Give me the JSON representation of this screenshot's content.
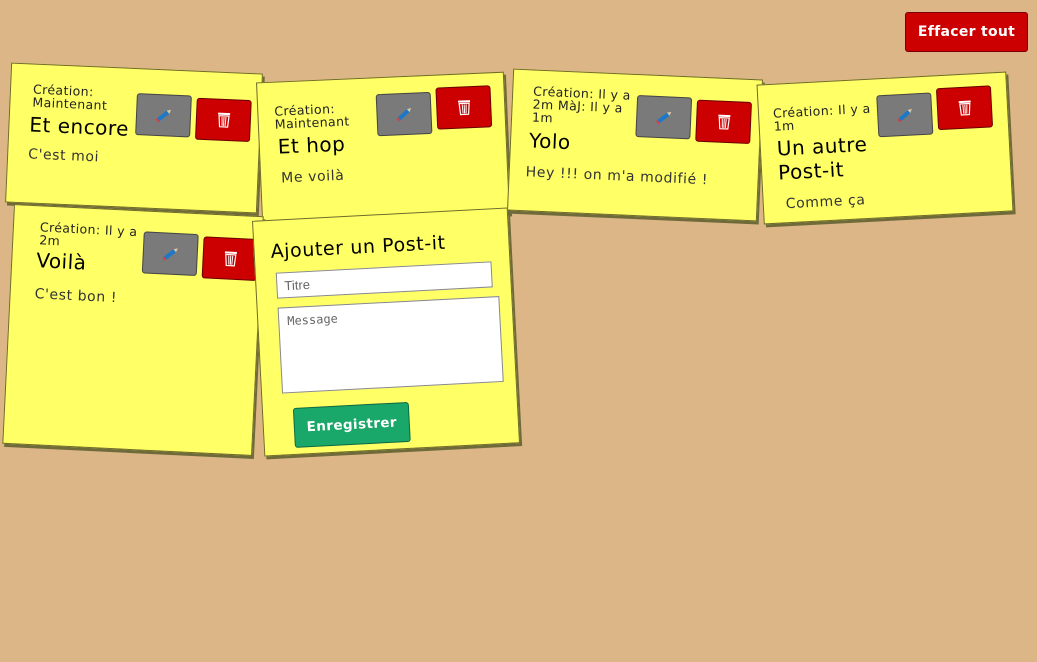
{
  "toolbar": {
    "clear_all_label": "Effacer tout"
  },
  "notes": [
    {
      "meta": "Création: Maintenant",
      "title": "Et encore",
      "text": "C'est moi"
    },
    {
      "meta": "Création: Maintenant",
      "title": "Et hop",
      "text": "Me voilà"
    },
    {
      "meta": "Création: Il y a 2m MàJ: Il y a 1m",
      "title": "Yolo",
      "text": "Hey !!! on m'a modifié !"
    },
    {
      "meta": "Création: Il y a 1m",
      "title": "Un autre Post-it",
      "text": "Comme ça"
    },
    {
      "meta": "Création: Il y a 2m",
      "title": "Voilà",
      "text": "C'est bon !"
    }
  ],
  "form": {
    "heading": "Ajouter un Post-it",
    "title_placeholder": "Titre",
    "message_placeholder": "Message",
    "submit_label": "Enregistrer"
  },
  "icons": {
    "edit": "pencil-icon",
    "delete": "trash-icon"
  },
  "colors": {
    "background": "#ddb688",
    "note": "#ffff66",
    "danger": "#cc0000",
    "edit": "#7a7a7a",
    "submit": "#1aa86a"
  }
}
